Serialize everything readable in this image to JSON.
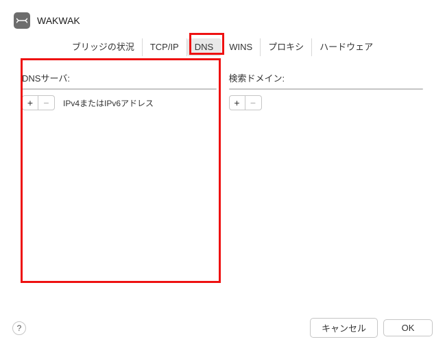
{
  "header": {
    "title": "WAKWAK"
  },
  "tabs": {
    "bridge": "ブリッジの状況",
    "tcpip": "TCP/IP",
    "dns": "DNS",
    "wins": "WINS",
    "proxy": "プロキシ",
    "hardware": "ハードウェア"
  },
  "panels": {
    "dns_servers_label": "DNSサーバ:",
    "search_domains_label": "検索ドメイン:",
    "hint_left": "IPv4またはIPv6アドレス",
    "add_symbol": "+",
    "remove_symbol": "−"
  },
  "footer": {
    "help": "?",
    "cancel": "キャンセル",
    "ok": "OK"
  }
}
